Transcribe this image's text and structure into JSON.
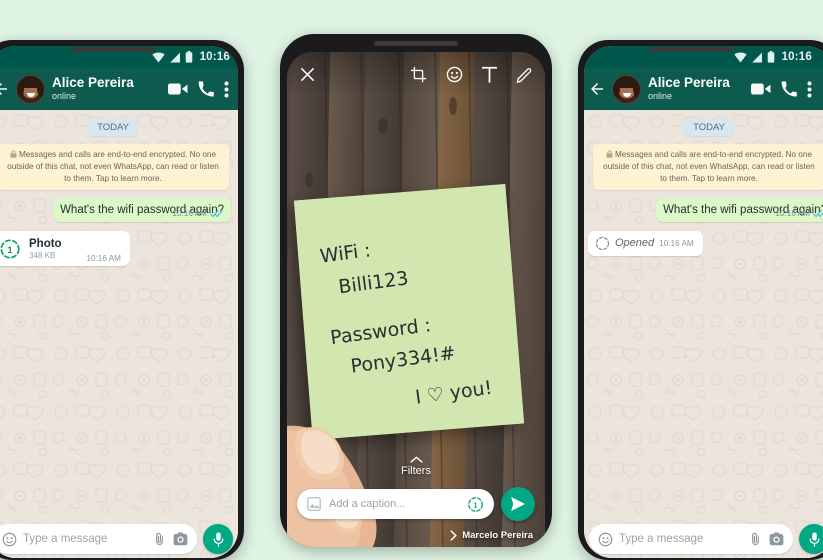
{
  "background_color": "#def3e3",
  "theme": {
    "header_green": "#0d5b4e",
    "statusbar_green": "#00584c",
    "outgoing_bubble": "#dcf8c6",
    "incoming_bubble": "#ffffff",
    "accent_teal": "#00a884",
    "chat_bg": "#ece5dd",
    "note_green": "#d9e9b8",
    "tick_blue": "#53bdeb"
  },
  "phones": {
    "left": {
      "status_bar": {
        "time": "10:16",
        "icons": [
          "wifi-icon",
          "signal-icon",
          "battery-icon"
        ]
      },
      "header": {
        "back_icon": "back-arrow-icon",
        "contact_name": "Alice Pereira",
        "presence": "online",
        "icons": [
          "video-call-icon",
          "voice-call-icon",
          "overflow-menu-icon"
        ]
      },
      "day_divider": "TODAY",
      "encryption_notice": "Messages and calls are end-to-end encrypted. No one outside of this chat, not even WhatsApp, can read or listen to them. Tap to learn more.",
      "messages": [
        {
          "kind": "text",
          "direction": "out",
          "text": "What's the wifi password again?",
          "time": "10:16 AM",
          "status": "read"
        },
        {
          "kind": "view-once-photo",
          "direction": "in",
          "title": "Photo",
          "size": "348 KB",
          "time": "10:16 AM"
        }
      ],
      "composer": {
        "emoji_icon": "emoji-icon",
        "placeholder": "Type a message",
        "attach_icon": "paperclip-icon",
        "camera_icon": "camera-icon",
        "mic_icon": "microphone-icon"
      }
    },
    "middle": {
      "edit_toolbar": {
        "close_icon": "close-icon",
        "crop_icon": "crop-rotate-icon",
        "sticker_icon": "sticker-emoji-icon",
        "text_icon": "add-text-icon",
        "draw_icon": "pencil-draw-icon"
      },
      "photo": {
        "description": "hand holding a green sticky note against a wooden plank wall",
        "note_lines": [
          "WiFi:",
          "Billi123",
          "Password:",
          "Pony334!#",
          "I ♡ you!"
        ]
      },
      "filters_label": "Filters",
      "filters_chevron": "chevron-up-icon",
      "caption": {
        "view_once_icon": "view-once-icon",
        "gallery_icon": "gallery-icon",
        "placeholder": "Add a caption...",
        "send_icon": "send-icon"
      },
      "recipient": {
        "chevron": "chevron-right-icon",
        "name": "Marcelo Pereira"
      }
    },
    "right": {
      "status_bar": {
        "time": "10:16",
        "icons": [
          "wifi-icon",
          "signal-icon",
          "battery-icon"
        ]
      },
      "header": {
        "back_icon": "back-arrow-icon",
        "contact_name": "Alice Pereira",
        "presence": "online",
        "icons": [
          "video-call-icon",
          "voice-call-icon",
          "overflow-menu-icon"
        ]
      },
      "day_divider": "TODAY",
      "encryption_notice": "Messages and calls are end-to-end encrypted. No one outside of this chat, not even WhatsApp, can read or listen to them. Tap to learn more.",
      "messages": [
        {
          "kind": "text",
          "direction": "out",
          "text": "What's the wifi password again?",
          "time": "10:16 AM",
          "status": "read"
        },
        {
          "kind": "opened-receipt",
          "direction": "in",
          "label": "Opened",
          "time": "10:16 AM"
        }
      ],
      "composer": {
        "emoji_icon": "emoji-icon",
        "placeholder": "Type a message",
        "attach_icon": "paperclip-icon",
        "camera_icon": "camera-icon",
        "mic_icon": "microphone-icon"
      }
    }
  }
}
